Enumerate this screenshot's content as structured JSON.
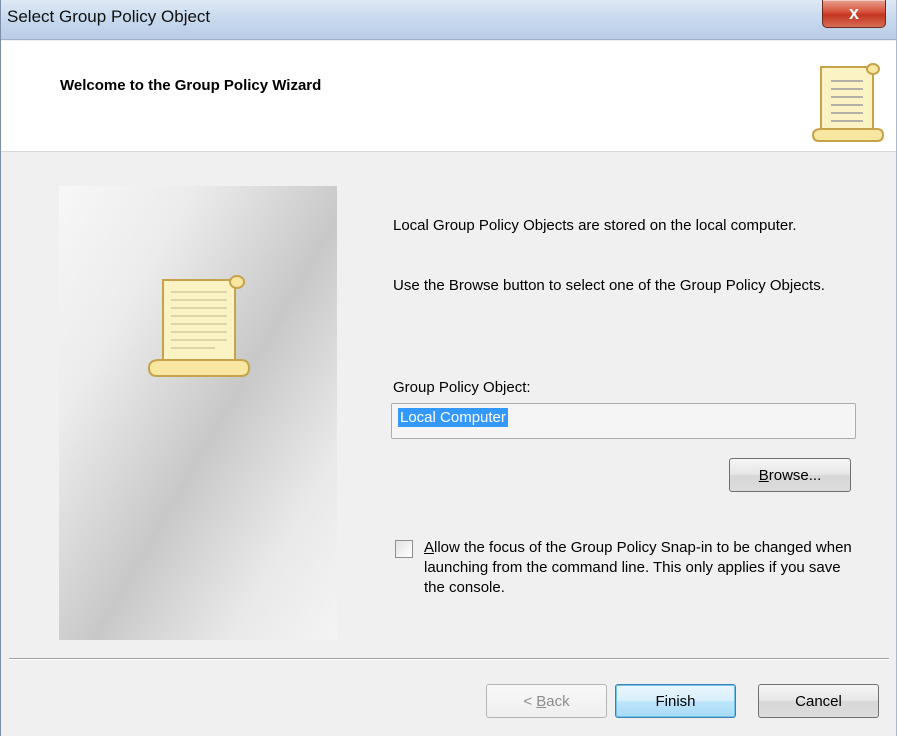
{
  "window": {
    "title": "Select Group Policy Object",
    "close_label": "x"
  },
  "header": {
    "title": "Welcome to the Group Policy Wizard"
  },
  "content": {
    "description_1": "Local Group Policy Objects are stored on the local computer.",
    "description_2": "Use the Browse button to select one of the Group Policy Objects.",
    "gpo_label": "Group Policy Object:",
    "gpo_value": "Local Computer",
    "browse_label_accel": "B",
    "browse_label_rest": "rowse...",
    "checkbox_checked": false,
    "checkbox_label_accel": "A",
    "checkbox_label_rest": "llow the focus of the Group Policy Snap-in to be changed when launching from the command line.  This only applies if you save the console."
  },
  "footer": {
    "back_prefix": "< ",
    "back_accel": "B",
    "back_rest": "ack",
    "finish_label": "Finish",
    "cancel_label": "Cancel"
  },
  "icons": {
    "header_icon": "scroll-icon",
    "panel_icon": "scroll-icon",
    "close_icon": "close-icon"
  }
}
